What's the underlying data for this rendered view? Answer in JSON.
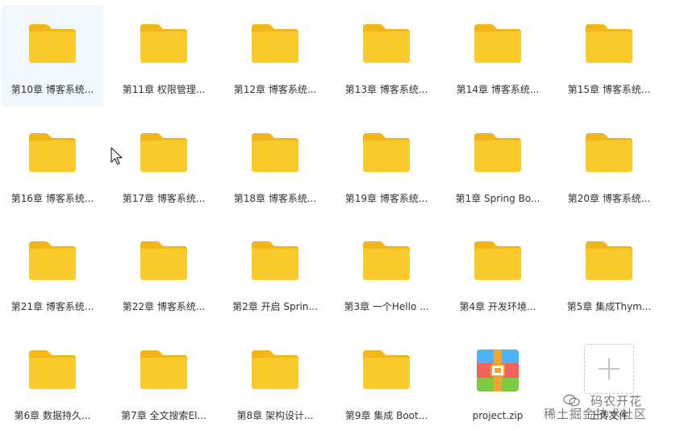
{
  "items": [
    {
      "type": "folder",
      "name": "第10章 博客系统...",
      "icon": "folder-icon",
      "selected": true
    },
    {
      "type": "folder",
      "name": "第11章 权限管理...",
      "icon": "folder-icon"
    },
    {
      "type": "folder",
      "name": "第12章 博客系统...",
      "icon": "folder-icon"
    },
    {
      "type": "folder",
      "name": "第13章 博客系统...",
      "icon": "folder-icon"
    },
    {
      "type": "folder",
      "name": "第14章 博客系统...",
      "icon": "folder-icon"
    },
    {
      "type": "folder",
      "name": "第15章 博客系统...",
      "icon": "folder-icon"
    },
    {
      "type": "folder",
      "name": "第16章 博客系统...",
      "icon": "folder-icon"
    },
    {
      "type": "folder",
      "name": "第17章 博客系统...",
      "icon": "folder-icon"
    },
    {
      "type": "folder",
      "name": "第18章 博客系统...",
      "icon": "folder-icon"
    },
    {
      "type": "folder",
      "name": "第19章 博客系统...",
      "icon": "folder-icon"
    },
    {
      "type": "folder",
      "name": "第1章 Spring Bo...",
      "icon": "folder-icon"
    },
    {
      "type": "folder",
      "name": "第20章 博客系统...",
      "icon": "folder-icon"
    },
    {
      "type": "folder",
      "name": "第21章 博客系统...",
      "icon": "folder-icon"
    },
    {
      "type": "folder",
      "name": "第22章 博客系统...",
      "icon": "folder-icon"
    },
    {
      "type": "folder",
      "name": "第2章 开启 Sprin...",
      "icon": "folder-icon"
    },
    {
      "type": "folder",
      "name": "第3章 一个Hello ...",
      "icon": "folder-icon"
    },
    {
      "type": "folder",
      "name": "第4章 开发环境...",
      "icon": "folder-icon"
    },
    {
      "type": "folder",
      "name": "第5章 集成Thym...",
      "icon": "folder-icon"
    },
    {
      "type": "folder",
      "name": "第6章 数据持久...",
      "icon": "folder-icon"
    },
    {
      "type": "folder",
      "name": "第7章 全文搜索El...",
      "icon": "folder-icon"
    },
    {
      "type": "folder",
      "name": "第8章 架构设计...",
      "icon": "folder-icon"
    },
    {
      "type": "folder",
      "name": "第9章 集成 Boot...",
      "icon": "folder-icon"
    },
    {
      "type": "archive",
      "name": "project.zip",
      "icon": "zip-archive-icon"
    },
    {
      "type": "upload",
      "name": "上传文件",
      "icon": "plus-icon"
    }
  ],
  "watermark": {
    "line1": "码农开花",
    "line2": "稀土掘金技术社区"
  },
  "colors": {
    "folder_body": "#FBCB2E",
    "folder_tab": "#F0B61A",
    "selection_bg": "#F0F7FD",
    "label_text": "#333333",
    "zip_blue": "#4DB3F3",
    "zip_red": "#F0625B",
    "zip_green": "#7DCB44",
    "zip_band": "#F2A531"
  }
}
